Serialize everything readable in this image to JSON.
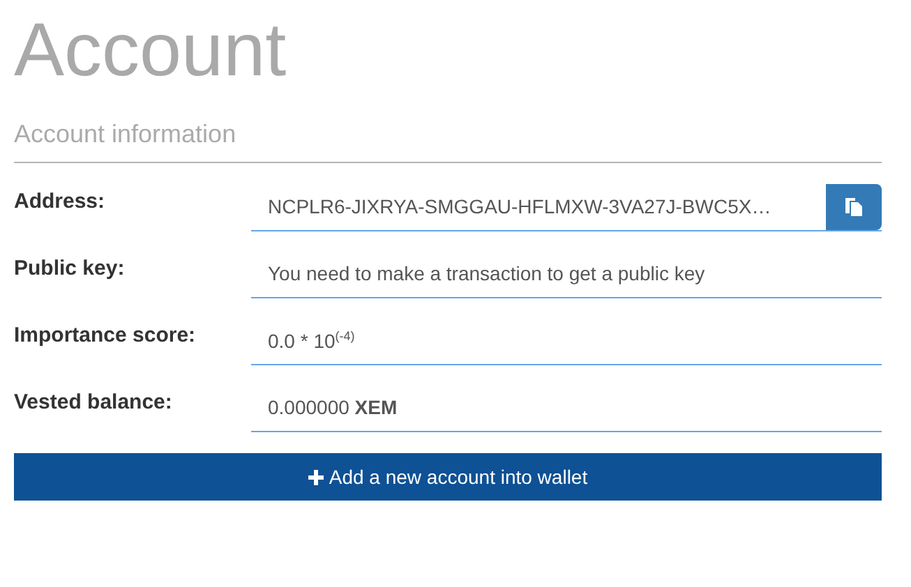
{
  "page_title": "Account",
  "section_title": "Account information",
  "fields": [
    {
      "label": "Address:",
      "value": "NCPLR6-JIXRYA-SMGGAU-HFLMXW-3VA27J-BWC5X…",
      "kind": "copyable"
    },
    {
      "label": "Public key:",
      "value": "You need to make a transaction to get a public key",
      "kind": "plain"
    },
    {
      "label": "Importance score:",
      "value": "0.0 * 10$^{(-4)}$",
      "kind": "plain"
    },
    {
      "label": "Vested balance:",
      "value": "0.000000 **XEM**",
      "kind": "plain"
    }
  ],
  "add_button": {
    "label": "Add a new account into wallet"
  }
}
